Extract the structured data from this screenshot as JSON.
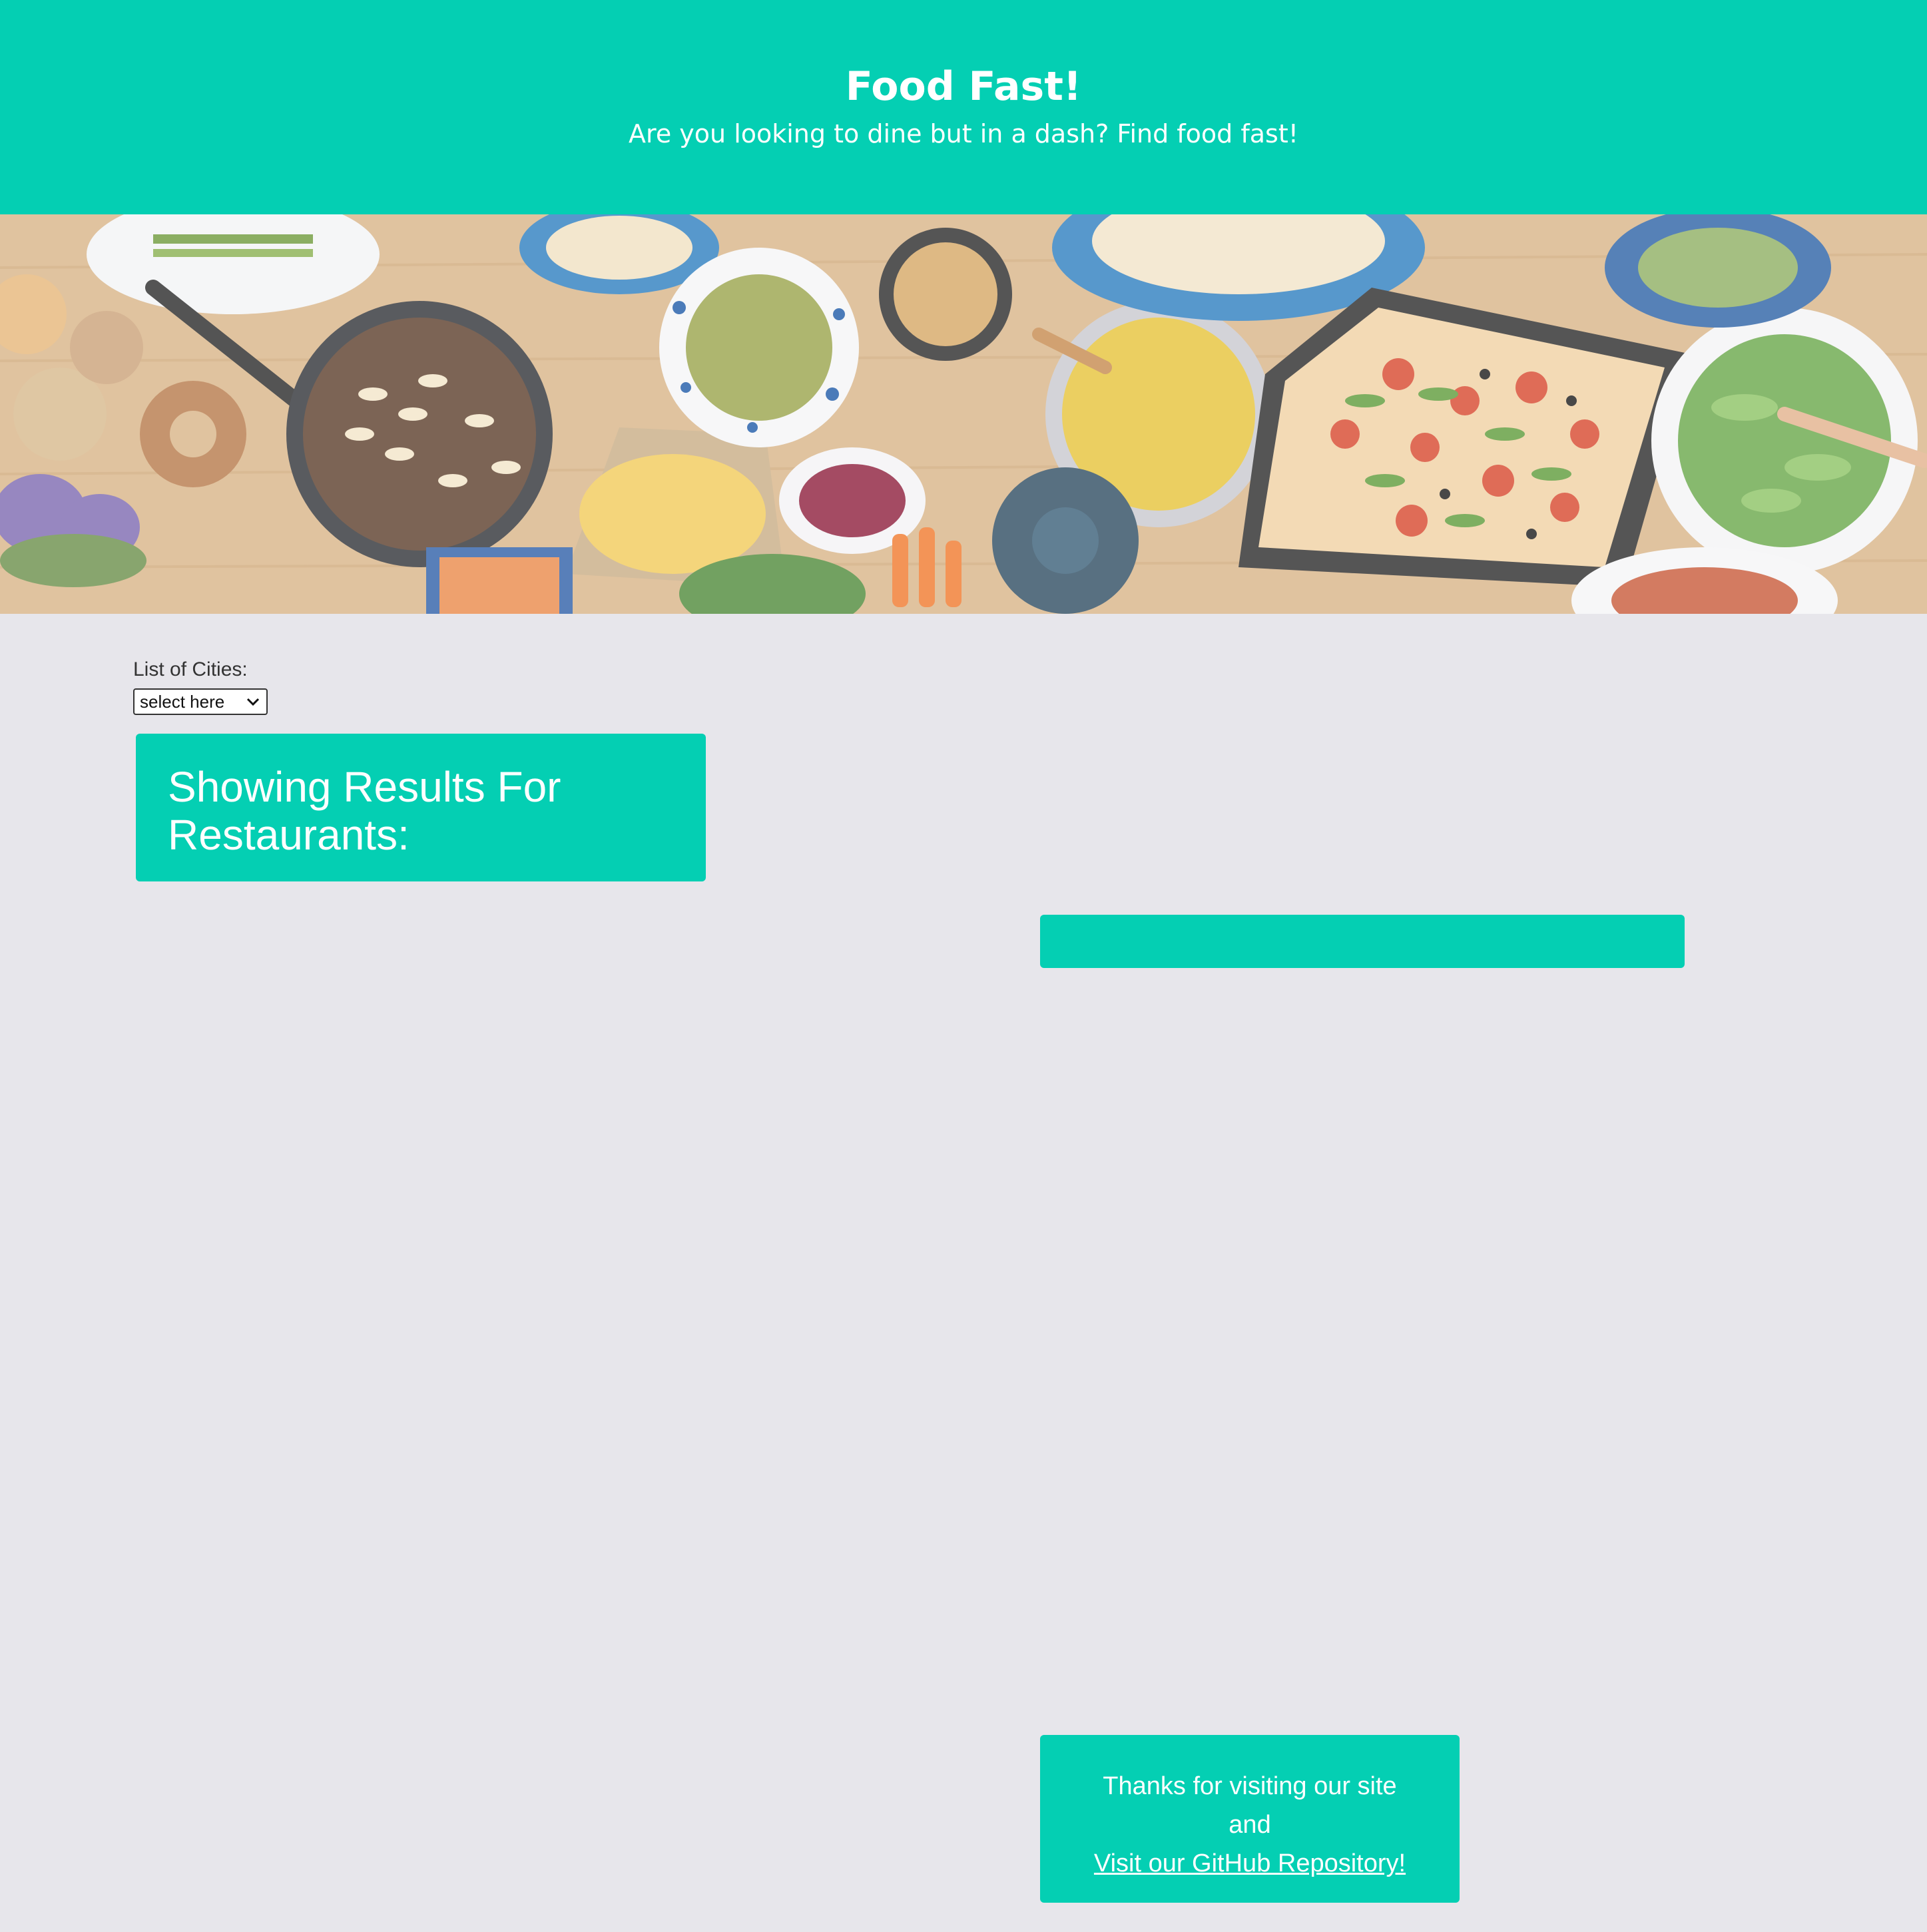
{
  "header": {
    "title": "Food Fast!",
    "subtitle": "Are you looking to dine but in a dash? Find food fast!"
  },
  "hero": {
    "image": "food-table-banner"
  },
  "filter": {
    "label": "List of Cities:",
    "select_value": "select here"
  },
  "results": {
    "heading_line1": "Showing Results For",
    "heading_line2": "Restaurants:"
  },
  "footer": {
    "line1": "Thanks for visiting our site",
    "line2": "and",
    "link_text": "Visit our GitHub Repository!"
  },
  "colors": {
    "accent": "#04cfb3",
    "background": "#e7e6eb",
    "text_on_accent": "#ffffff"
  }
}
